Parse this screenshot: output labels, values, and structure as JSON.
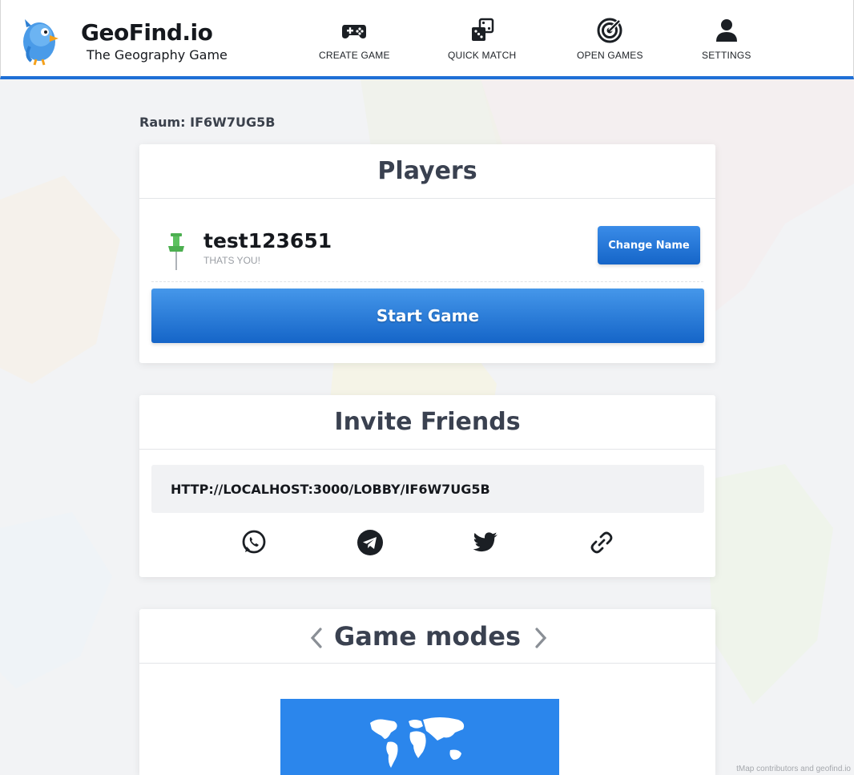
{
  "brand": {
    "title": "GeoFind.io",
    "subtitle": "The Geography Game"
  },
  "nav": [
    {
      "label": "CREATE GAME",
      "icon": "gamepad-icon"
    },
    {
      "label": "QUICK MATCH",
      "icon": "dice-icon"
    },
    {
      "label": "OPEN GAMES",
      "icon": "radar-icon"
    },
    {
      "label": "SETTINGS",
      "icon": "user-icon"
    }
  ],
  "room": {
    "label": "Raum: IF6W7UG5B"
  },
  "players": {
    "title": "Players",
    "list": [
      {
        "name": "test123651",
        "note": "THATS YOU!",
        "pin_color": "#4caf50"
      }
    ],
    "change_name_label": "Change Name",
    "start_label": "Start Game"
  },
  "invite": {
    "title": "Invite Friends",
    "link": "HTTP://LOCALHOST:3000/LOBBY/IF6W7UG5B",
    "share_icons": [
      "whatsapp-icon",
      "telegram-icon",
      "twitter-icon",
      "link-icon"
    ]
  },
  "modes": {
    "title": "Game modes"
  },
  "colors": {
    "accent": "#1f6fd6",
    "button": "#1a6fd4",
    "tile": "#2b86ec"
  }
}
